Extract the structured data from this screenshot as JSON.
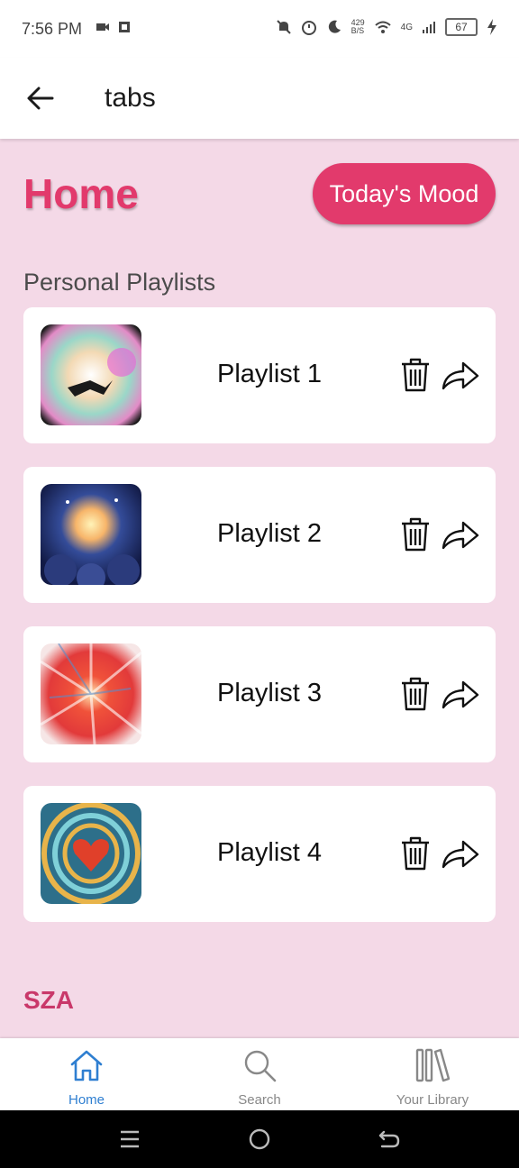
{
  "status_bar": {
    "time": "7:56 PM",
    "net_speed": "429\nB/S",
    "network": "4G",
    "battery": "67"
  },
  "app_bar": {
    "title": "tabs"
  },
  "home": {
    "title": "Home",
    "mood_button": "Today's Mood"
  },
  "section": {
    "title": "Personal Playlists"
  },
  "playlists": [
    {
      "label": "Playlist 1"
    },
    {
      "label": "Playlist 2"
    },
    {
      "label": "Playlist 3"
    },
    {
      "label": "Playlist 4"
    }
  ],
  "artist_section": "SZA",
  "bottom_nav": [
    {
      "label": "Home",
      "active": true
    },
    {
      "label": "Search",
      "active": false
    },
    {
      "label": "Your Library",
      "active": false
    }
  ],
  "colors": {
    "accent": "#e23a6c",
    "background": "#f4d9e7",
    "nav_active": "#2f7fd1",
    "nav_inactive": "#888888"
  }
}
